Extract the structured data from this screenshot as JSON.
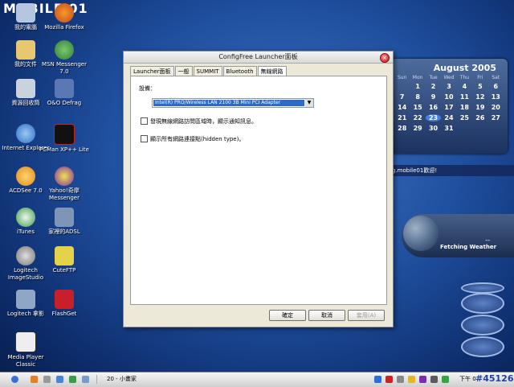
{
  "desktop": {
    "logo_text": "MOBILE 01",
    "icons": [
      {
        "label": "我的電腦"
      },
      {
        "label": "Mozilla Firefox"
      },
      {
        "label": "我的文件"
      },
      {
        "label": "MSN Messenger 7.0"
      },
      {
        "label": "資源回收筒"
      },
      {
        "label": "O&O Defrag"
      },
      {
        "label": "Internet Explorer"
      },
      {
        "label": "PCMan XP++ Lite"
      },
      {
        "label": "ACDSee 7.0"
      },
      {
        "label": "Yahoo!奇摩 Messenger"
      },
      {
        "label": "iTunes"
      },
      {
        "label": "家裡的ADSL"
      },
      {
        "label": "Logitech ImageStudio"
      },
      {
        "label": "CuteFTP"
      },
      {
        "label": "Logitech 拿影"
      },
      {
        "label": "FlashGet"
      },
      {
        "label": "Media Player Classic"
      }
    ]
  },
  "window": {
    "title": "ConfigFree Launcher面板",
    "close_symbol": "×",
    "tabs": [
      "Launcher面板",
      "一般",
      "SUMMIT",
      "Bluetooth",
      "無線網路"
    ],
    "device_label": "設備：",
    "device_value": "Intel(R) PRO/Wireless LAN 2100 3B Mini PCI Adapter",
    "checkbox1_label": "發現無線網路訪問區域時，顯示通知訊息。",
    "checkbox2_label": "顯示所有網路連接點(hidden type)。",
    "ok_label": "確定",
    "cancel_label": "取消",
    "apply_label": "套用(A)"
  },
  "calendar": {
    "title": "August 2005",
    "days": [
      "Sun",
      "Mon",
      "Tue",
      "Wed",
      "Thu",
      "Fri",
      "Sat"
    ],
    "dates": [
      "",
      "1",
      "2",
      "3",
      "4",
      "5",
      "6",
      "7",
      "8",
      "9",
      "10",
      "11",
      "12",
      "13",
      "14",
      "15",
      "16",
      "17",
      "18",
      "19",
      "20",
      "21",
      "22",
      "23",
      "24",
      "25",
      "26",
      "27",
      "28",
      "29",
      "30",
      "31",
      "",
      "",
      ""
    ],
    "selected": "23"
  },
  "message": {
    "text": "g.mobile01歡迎!"
  },
  "weather": {
    "text": "Fetching Weather",
    "value": "--"
  },
  "taskbar": {
    "task_label": "20 - 小畫家",
    "clock": "下午 0",
    "counter": "#45126"
  },
  "colors": {
    "accent": "#316ac5",
    "close": "#c81d1d"
  }
}
